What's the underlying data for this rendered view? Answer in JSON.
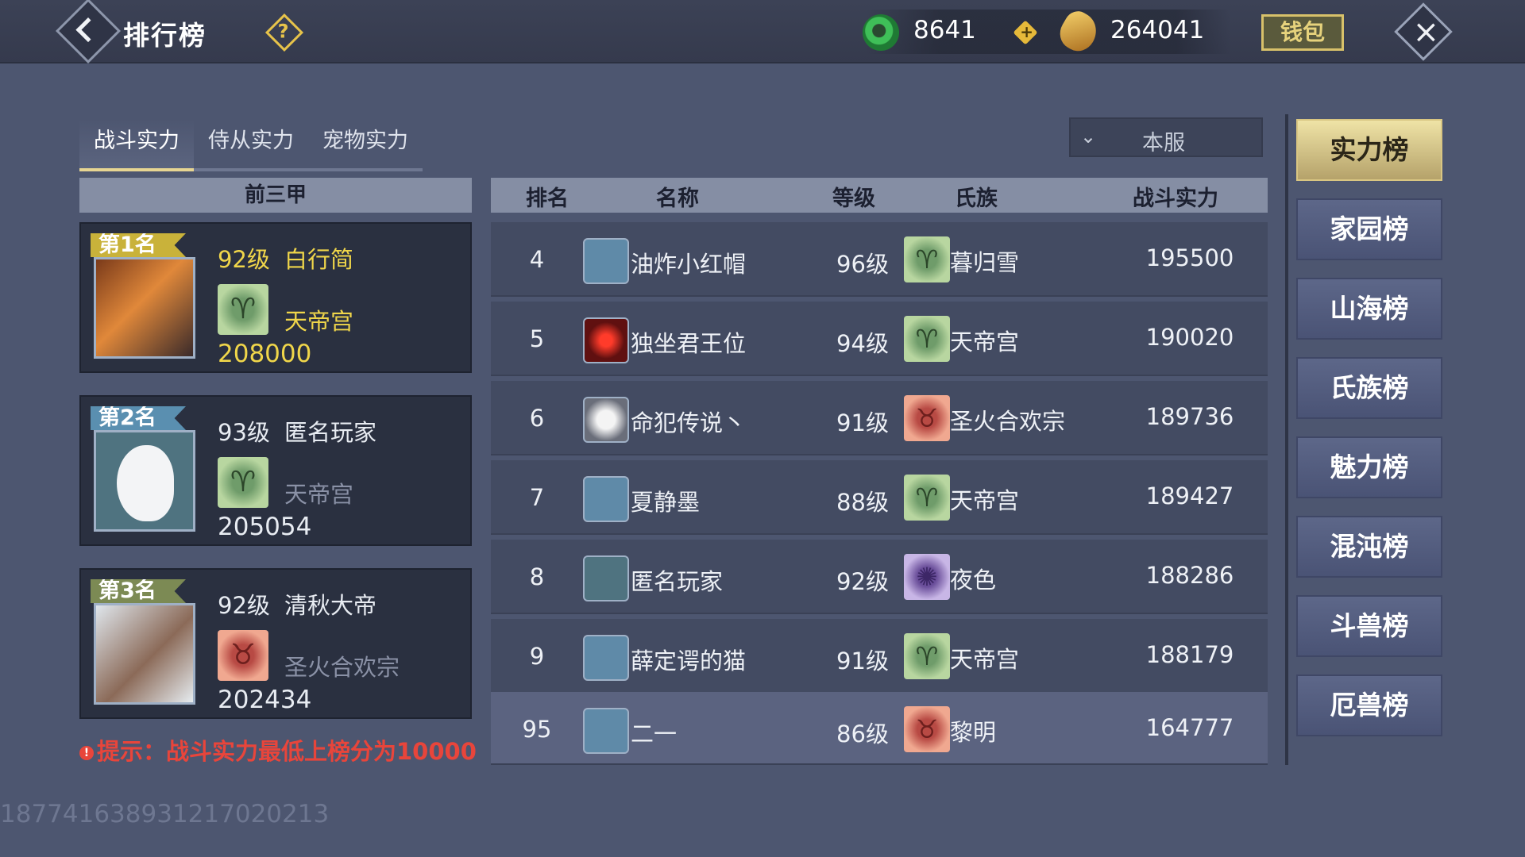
{
  "header": {
    "title": "排行榜",
    "currency1": "8641",
    "currency2": "264041",
    "wallet_label": "钱包"
  },
  "tabs": [
    {
      "label": "战斗实力",
      "active": true
    },
    {
      "label": "侍从实力",
      "active": false
    },
    {
      "label": "宠物实力",
      "active": false
    }
  ],
  "server_select": {
    "value": "本服"
  },
  "top3": {
    "header": "前三甲",
    "entries": [
      {
        "rank": "第1名",
        "level": "92级",
        "name": "白行简",
        "clan": "天帝宫",
        "power": "208000",
        "banner_color": "#c9b23a",
        "name_color": "#f0d64a"
      },
      {
        "rank": "第2名",
        "level": "93级",
        "name": "匿名玩家",
        "clan": "天帝宫",
        "power": "205054",
        "banner_color": "#5a8fb0",
        "name_color": "#f2f4f8"
      },
      {
        "rank": "第3名",
        "level": "92级",
        "name": "清秋大帝",
        "clan": "圣火合欢宗",
        "power": "202434",
        "banner_color": "#7c8a54",
        "name_color": "#f2f4f8"
      }
    ],
    "tip": "提示：战斗实力最低上榜分为10000"
  },
  "table": {
    "columns": [
      "排名",
      "名称",
      "等级",
      "氏族",
      "战斗实力"
    ],
    "rows": [
      {
        "rank": "4",
        "name": "油炸小红帽",
        "level": "96级",
        "clan": "暮归雪",
        "power": "195500",
        "avatar": "blue",
        "emblem": "green"
      },
      {
        "rank": "5",
        "name": "独坐君王位",
        "level": "94级",
        "clan": "天帝宫",
        "power": "190020",
        "avatar": "red",
        "emblem": "green"
      },
      {
        "rank": "6",
        "name": "命犯传说丶",
        "level": "91级",
        "clan": "圣火合欢宗",
        "power": "189736",
        "avatar": "white",
        "emblem": "red"
      },
      {
        "rank": "7",
        "name": "夏静墨",
        "level": "88级",
        "clan": "天帝宫",
        "power": "189427",
        "avatar": "blue",
        "emblem": "green"
      },
      {
        "rank": "8",
        "name": "匿名玩家",
        "level": "92级",
        "clan": "夜色",
        "power": "188286",
        "avatar": "plain",
        "emblem": "purple"
      },
      {
        "rank": "9",
        "name": "薛定谔的猫",
        "level": "91级",
        "clan": "天帝宫",
        "power": "188179",
        "avatar": "blue",
        "emblem": "green"
      }
    ],
    "self": {
      "rank": "95",
      "name": "二一",
      "level": "86级",
      "clan": "黎明",
      "power": "164777",
      "avatar": "blue",
      "emblem": "red"
    }
  },
  "side_nav": [
    {
      "label": "实力榜",
      "active": true
    },
    {
      "label": "家园榜",
      "active": false
    },
    {
      "label": "山海榜",
      "active": false
    },
    {
      "label": "氏族榜",
      "active": false
    },
    {
      "label": "魅力榜",
      "active": false
    },
    {
      "label": "混沌榜",
      "active": false
    },
    {
      "label": "斗兽榜",
      "active": false
    },
    {
      "label": "厄兽榜",
      "active": false
    }
  ],
  "watermark": "187741638931217020213"
}
